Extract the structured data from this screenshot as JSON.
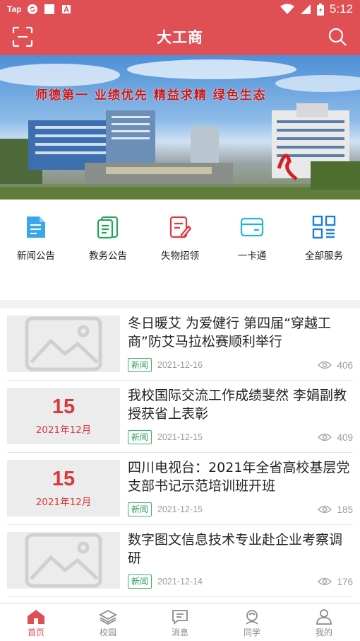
{
  "status_bar": {
    "carrier": "Tap",
    "time": "5:12"
  },
  "header": {
    "title": "大工商"
  },
  "banner": {
    "slogan": "师德第一  业绩优先  精益求精  绿色生态"
  },
  "services": [
    {
      "label": "新闻公告",
      "icon": "news-doc-icon",
      "color": "#1f9be4"
    },
    {
      "label": "教务公告",
      "icon": "clipboard-icon",
      "color": "#25a55b"
    },
    {
      "label": "失物招领",
      "icon": "edit-doc-icon",
      "color": "#e0393f"
    },
    {
      "label": "一卡通",
      "icon": "card-icon",
      "color": "#1fb6d6"
    },
    {
      "label": "全部服务",
      "icon": "grid-icon",
      "color": "#1f7fd6"
    }
  ],
  "news": [
    {
      "title": "冬日暖艾  为爱健行  第四届“穿越工商”防艾马拉松赛顺利举行",
      "tag": "新闻",
      "date": "2021-12-16",
      "views": "406",
      "thumb": "placeholder"
    },
    {
      "title": "我校国际交流工作成绩斐然  李娟副教授获省上表彰",
      "tag": "新闻",
      "date": "2021-12-15",
      "views": "409",
      "thumb": "date",
      "thumb_day": "15",
      "thumb_month": "2021年12月"
    },
    {
      "title": "四川电视台：2021年全省高校基层党支部书记示范培训班开班",
      "tag": "新闻",
      "date": "2021-12-15",
      "views": "185",
      "thumb": "date",
      "thumb_day": "15",
      "thumb_month": "2021年12月"
    },
    {
      "title": "数字图文信息技术专业赴企业考察调研",
      "tag": "新闻",
      "date": "2021-12-14",
      "views": "176",
      "thumb": "placeholder"
    }
  ],
  "tabbar": [
    {
      "label": "首页",
      "icon": "home-icon",
      "active": true
    },
    {
      "label": "校园",
      "icon": "layers-icon",
      "active": false
    },
    {
      "label": "消息",
      "icon": "message-icon",
      "active": false
    },
    {
      "label": "同学",
      "icon": "classmates-icon",
      "active": false
    },
    {
      "label": "我的",
      "icon": "profile-icon",
      "active": false
    }
  ],
  "colors": {
    "brand": "#e04f53",
    "tag_green": "#3cb36a",
    "date_red": "#d9383c"
  }
}
